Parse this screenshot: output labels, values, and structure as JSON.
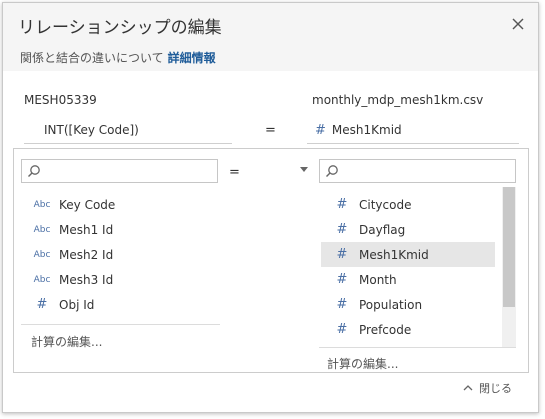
{
  "dialog": {
    "title": "リレーションシップの編集",
    "subtitle": "関係と結合の違いについて",
    "subtitle_link": "詳細情報"
  },
  "left_source": {
    "name": "MESH05339",
    "field": "INT([Key Code])",
    "search_placeholder": "",
    "items": [
      {
        "type": "Abc",
        "label": "Key Code"
      },
      {
        "type": "Abc",
        "label": "Mesh1 Id"
      },
      {
        "type": "Abc",
        "label": "Mesh2 Id"
      },
      {
        "type": "Abc",
        "label": "Mesh3 Id"
      },
      {
        "type": "#",
        "label": "Obj Id"
      }
    ],
    "calc_label": "計算の編集..."
  },
  "right_source": {
    "name": "monthly_mdp_mesh1km.csv",
    "field_icon": "#",
    "field": "Mesh1Kmid",
    "search_placeholder": "",
    "items": [
      {
        "type": "#",
        "label": "Citycode"
      },
      {
        "type": "#",
        "label": "Dayflag"
      },
      {
        "type": "#",
        "label": "Mesh1Kmid",
        "selected": true
      },
      {
        "type": "#",
        "label": "Month"
      },
      {
        "type": "#",
        "label": "Population"
      },
      {
        "type": "#",
        "label": "Prefcode"
      }
    ],
    "calc_label": "計算の編集..."
  },
  "operator": "=",
  "footer": {
    "close_label": "閉じる"
  },
  "colors": {
    "accent": "#1f5c99",
    "icon": "#4a6fa5",
    "selected_bg": "#e6e6e6"
  }
}
